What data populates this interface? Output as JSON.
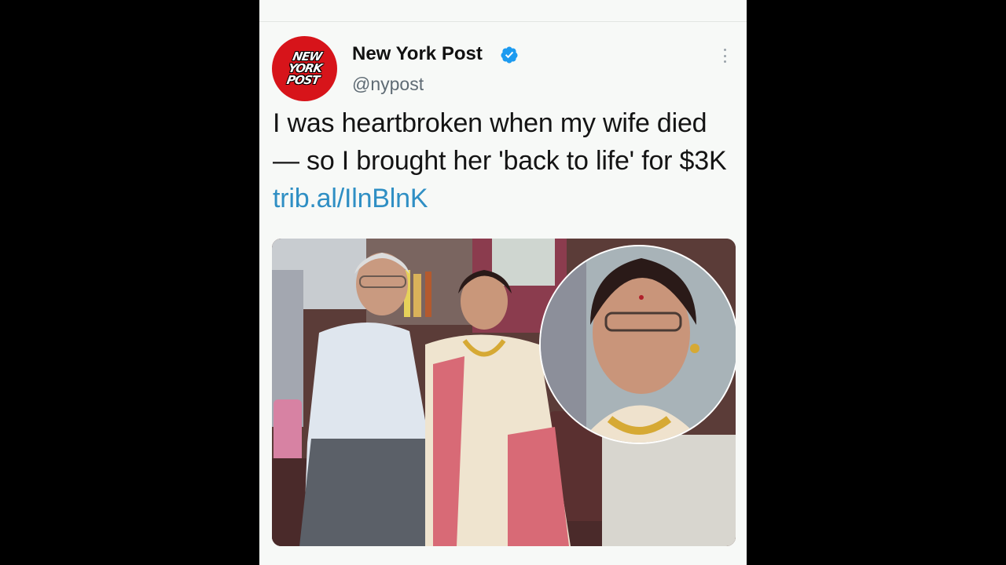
{
  "tweet": {
    "author": {
      "display_name": "New York Post",
      "handle": "@nypost",
      "verified": true,
      "avatar_logo_lines": [
        "NEW",
        "YORK",
        "POST"
      ],
      "avatar_color": "#d7141a"
    },
    "text": "I was heartbroken when my wife died — so I brought her 'back to life' for $3K ",
    "link": "trib.al/IlnBlnK",
    "link_color": "#2f8fc4",
    "media": {
      "type": "photo",
      "content": "photo-of-elderly-couple-seated-with-circular-closeup-inset"
    }
  },
  "icons": {
    "verified": "verified-badge-icon",
    "more": "more-options-icon"
  },
  "colors": {
    "background": "#000000",
    "card": "#f7f9f7",
    "verified_blue": "#1d9bf0",
    "text": "#141414",
    "secondary_text": "#5f6b74"
  }
}
